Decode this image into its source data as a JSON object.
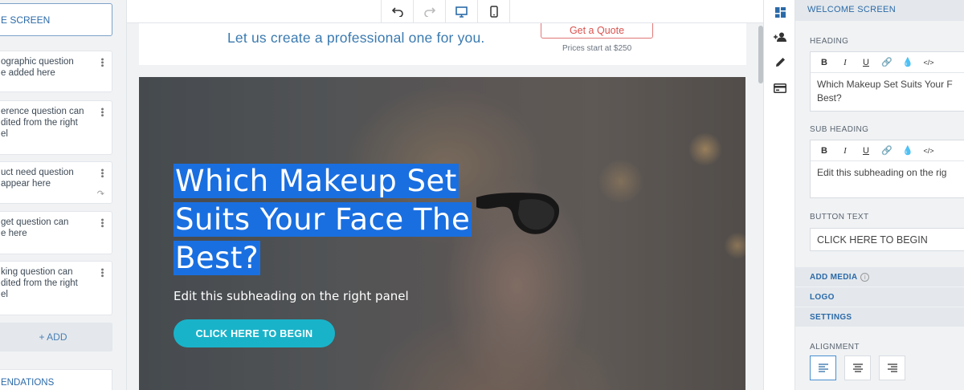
{
  "left_sidebar": {
    "welcome_label": "E SCREEN",
    "items": [
      {
        "text": "ographic question\ne added here"
      },
      {
        "text": "erence question can\ndited from the right\nel"
      },
      {
        "text": "uct need question\nappear here"
      },
      {
        "text": "get question can\ne here"
      },
      {
        "text": "king question can\ndited from the right\nel"
      }
    ],
    "add_label": "+ ADD",
    "recommendations_label": "ENDATIONS"
  },
  "toolbar": {
    "icons": [
      "undo-icon",
      "redo-icon",
      "desktop-icon",
      "mobile-icon"
    ]
  },
  "canvas": {
    "banner_text": "Let us create a professional one for you.",
    "quote_button": "Get a Quote",
    "price_text": "Prices start at $250",
    "heading_lines": [
      "Which Makeup Set",
      "Suits Your Face The",
      "Best?"
    ],
    "subheading": "Edit this subheading on the right panel",
    "begin_button": "CLICK HERE TO BEGIN"
  },
  "right_panel": {
    "title": "WELCOME SCREEN",
    "heading_label": "HEADING",
    "heading_value": "Which Makeup Set Suits Your F\nBest?",
    "subheading_label": "SUB HEADING",
    "subheading_value": "Edit this subheading on the rig",
    "button_text_label": "BUTTON TEXT",
    "button_text_value": "CLICK HERE TO BEGIN",
    "add_media": "ADD MEDIA",
    "logo": "LOGO",
    "settings": "SETTINGS",
    "alignment_label": "ALIGNMENT"
  },
  "colors": {
    "accent": "#2b6aa8",
    "button": "#19b3c9",
    "highlight": "#1a6fe0",
    "quote": "#d9534f"
  }
}
